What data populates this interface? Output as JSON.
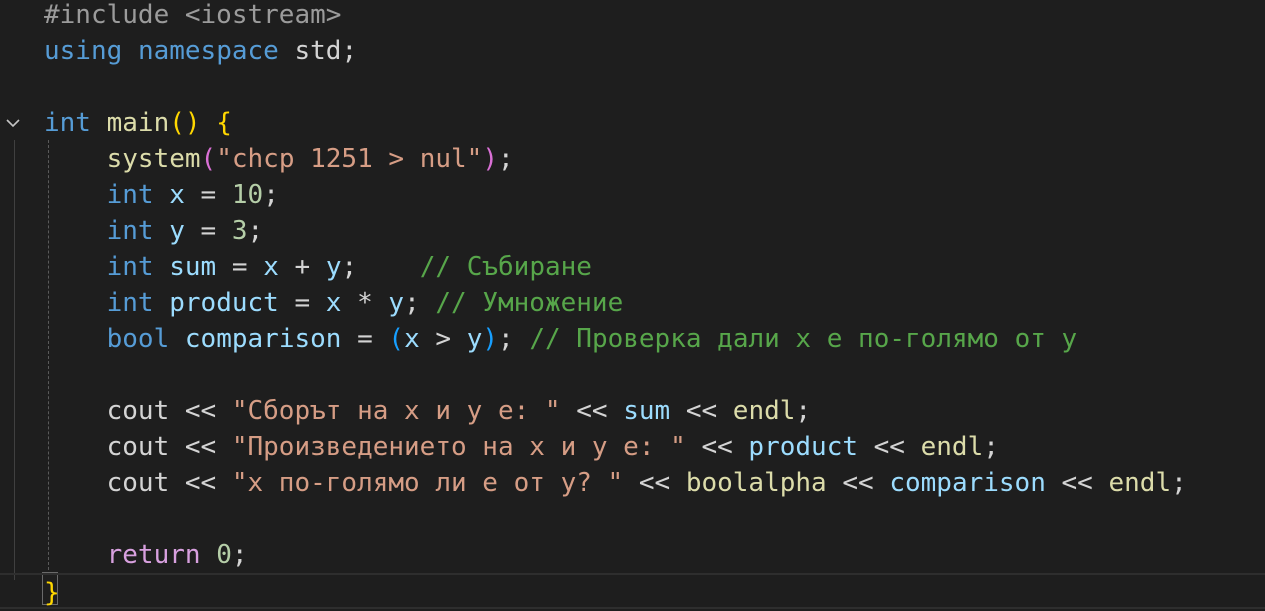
{
  "editor": {
    "fold_icon": "chevron-down-icon",
    "lines": [
      [
        [
          "pp",
          "#include <iostream>"
        ]
      ],
      [
        [
          "kw",
          "using"
        ],
        [
          "plain",
          " "
        ],
        [
          "kw",
          "namespace"
        ],
        [
          "plain",
          " std;"
        ]
      ],
      [],
      [
        [
          "kw",
          "int"
        ],
        [
          "plain",
          " "
        ],
        [
          "fn",
          "main"
        ],
        [
          "br1",
          "()"
        ],
        [
          "plain",
          " "
        ],
        [
          "br1",
          "{"
        ]
      ],
      [
        [
          "plain",
          "    "
        ],
        [
          "fn",
          "system"
        ],
        [
          "br2",
          "("
        ],
        [
          "str",
          "\"chcp 1251 > nul\""
        ],
        [
          "br2",
          ")"
        ],
        [
          "plain",
          ";"
        ]
      ],
      [
        [
          "plain",
          "    "
        ],
        [
          "kw",
          "int"
        ],
        [
          "plain",
          " "
        ],
        [
          "var",
          "x"
        ],
        [
          "plain",
          " = "
        ],
        [
          "num",
          "10"
        ],
        [
          "plain",
          ";"
        ]
      ],
      [
        [
          "plain",
          "    "
        ],
        [
          "kw",
          "int"
        ],
        [
          "plain",
          " "
        ],
        [
          "var",
          "y"
        ],
        [
          "plain",
          " = "
        ],
        [
          "num",
          "3"
        ],
        [
          "plain",
          ";"
        ]
      ],
      [
        [
          "plain",
          "    "
        ],
        [
          "kw",
          "int"
        ],
        [
          "plain",
          " "
        ],
        [
          "var",
          "sum"
        ],
        [
          "plain",
          " = "
        ],
        [
          "var",
          "x"
        ],
        [
          "plain",
          " + "
        ],
        [
          "var",
          "y"
        ],
        [
          "plain",
          ";    "
        ],
        [
          "com",
          "// Събиране"
        ]
      ],
      [
        [
          "plain",
          "    "
        ],
        [
          "kw",
          "int"
        ],
        [
          "plain",
          " "
        ],
        [
          "var",
          "product"
        ],
        [
          "plain",
          " = "
        ],
        [
          "var",
          "x"
        ],
        [
          "plain",
          " * "
        ],
        [
          "var",
          "y"
        ],
        [
          "plain",
          "; "
        ],
        [
          "com",
          "// Умножение"
        ]
      ],
      [
        [
          "plain",
          "    "
        ],
        [
          "kw",
          "bool"
        ],
        [
          "plain",
          " "
        ],
        [
          "var",
          "comparison"
        ],
        [
          "plain",
          " = "
        ],
        [
          "br3",
          "("
        ],
        [
          "var",
          "x"
        ],
        [
          "plain",
          " > "
        ],
        [
          "var",
          "y"
        ],
        [
          "br3",
          ")"
        ],
        [
          "plain",
          "; "
        ],
        [
          "com",
          "// Проверка дали x е по-голямо от y"
        ]
      ],
      [],
      [
        [
          "plain",
          "    cout << "
        ],
        [
          "str",
          "\"Сборът на x и y е: \""
        ],
        [
          "plain",
          " << "
        ],
        [
          "var",
          "sum"
        ],
        [
          "plain",
          " << "
        ],
        [
          "fn",
          "endl"
        ],
        [
          "plain",
          ";"
        ]
      ],
      [
        [
          "plain",
          "    cout << "
        ],
        [
          "str",
          "\"Произведението на x и y е: \""
        ],
        [
          "plain",
          " << "
        ],
        [
          "var",
          "product"
        ],
        [
          "plain",
          " << "
        ],
        [
          "fn",
          "endl"
        ],
        [
          "plain",
          ";"
        ]
      ],
      [
        [
          "plain",
          "    cout << "
        ],
        [
          "str",
          "\"x по-голямо ли е от y? \""
        ],
        [
          "plain",
          " << "
        ],
        [
          "fn",
          "boolalpha"
        ],
        [
          "plain",
          " << "
        ],
        [
          "var",
          "comparison"
        ],
        [
          "plain",
          " << "
        ],
        [
          "fn",
          "endl"
        ],
        [
          "plain",
          ";"
        ]
      ],
      [],
      [
        [
          "plain",
          "    "
        ],
        [
          "ctrl",
          "return"
        ],
        [
          "plain",
          " "
        ],
        [
          "num",
          "0"
        ],
        [
          "plain",
          ";"
        ]
      ],
      [
        [
          "br1",
          "}"
        ]
      ]
    ]
  }
}
